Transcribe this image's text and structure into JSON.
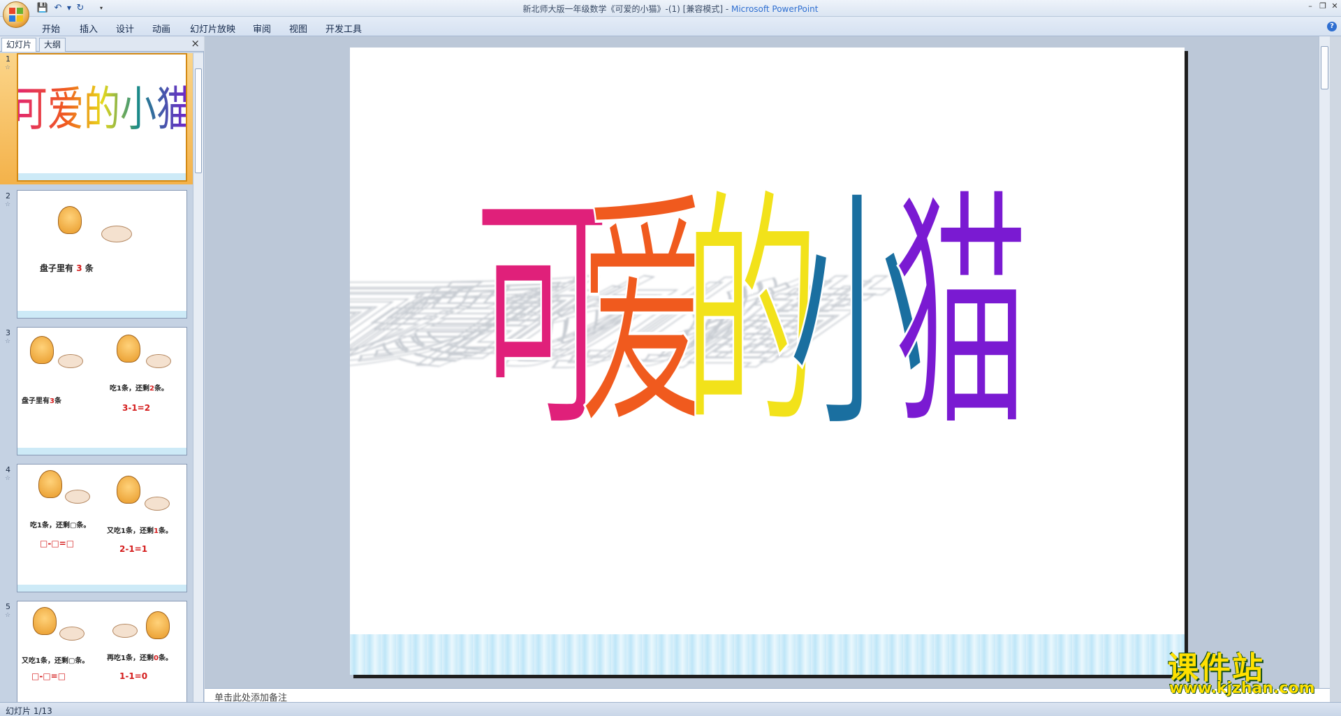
{
  "window": {
    "title_doc": "新北师大版一年级数学《可爱的小猫》-(1) [兼容模式] - ",
    "title_app": "Microsoft PowerPoint"
  },
  "ribbon": {
    "tabs": [
      "开始",
      "插入",
      "设计",
      "动画",
      "幻灯片放映",
      "审阅",
      "视图",
      "开发工具"
    ]
  },
  "pane": {
    "tab_slides": "幻灯片",
    "tab_outline": "大纲",
    "close": "×"
  },
  "thumbnails": [
    {
      "num": "1",
      "title": "可爱的小猫"
    },
    {
      "num": "2",
      "text_a": "盘子里有",
      "num_a": "3",
      "text_b": "条"
    },
    {
      "num": "3",
      "text_a": "盘子里有",
      "num_a": "3",
      "text_b": "条",
      "text_c": "吃1条，还剩",
      "num_c": "2",
      "text_d": "条。",
      "eq": "3-1=2"
    },
    {
      "num": "4",
      "text_a": "吃1条，还剩",
      "text_b": "条。",
      "eq_a": "□-□=□",
      "text_c": "又吃1条，还剩",
      "num_c": "1",
      "text_d": "条。",
      "eq_b": "2-1=1"
    },
    {
      "num": "5",
      "text_a": "又吃1条，还剩",
      "text_b": "条。",
      "eq_a": "□-□=□",
      "text_c": "再吃1条，还剩",
      "num_c": "0",
      "text_d": "条。",
      "eq_b": "1-1=0"
    }
  ],
  "slide": {
    "title_chars": [
      "可",
      "爱",
      "的",
      "小",
      "猫"
    ],
    "char_colors": [
      "#e0207a",
      "#f05a1e",
      "#f2e21a",
      "#1a6fa0",
      "#7a1ad2"
    ]
  },
  "notes": {
    "placeholder": "单击此处添加备注"
  },
  "status": {
    "text": "幻灯片 1/13"
  },
  "watermark": {
    "title": "课件站",
    "url": "www.kjzhan.com"
  }
}
